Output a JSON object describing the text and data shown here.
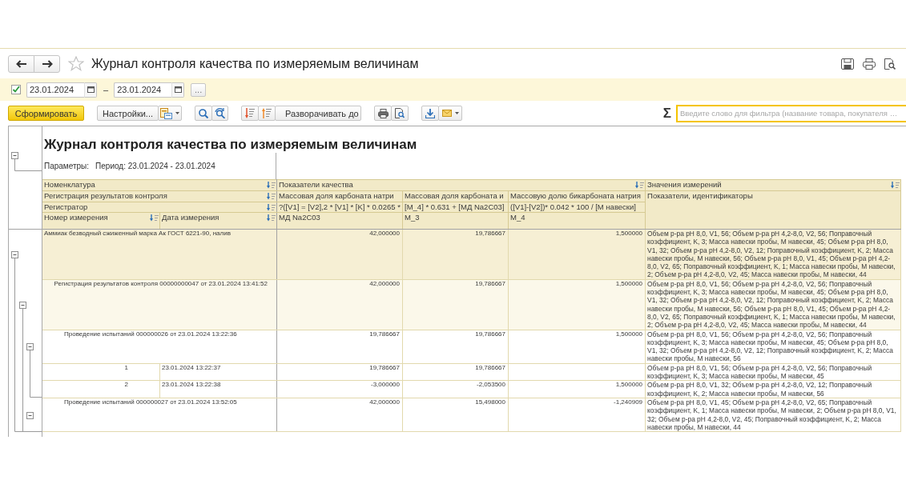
{
  "window": {
    "title": "Журнал контроля качества по измеряемым величинам"
  },
  "period": {
    "enabled": true,
    "from": "23.01.2024",
    "separator": "–",
    "to": "23.01.2024",
    "more_button": "..."
  },
  "toolbar": {
    "generate_button": "Сформировать",
    "settings_button": "Настройки...",
    "expand_button": "Разворачивать до",
    "sum_button": "Σ",
    "filter": {
      "placeholder": "Введите слово для фильтра (название товара, покупателя …"
    }
  },
  "report": {
    "title": "Журнал контроля качества по измеряемым величинам",
    "expanded": true,
    "parameters_label": "Параметры:",
    "period": "Период: 23.01.2024 - 23.01.2024",
    "header": {
      "nomenclature": "Номенклатура",
      "registration": "Регистрация результатов контроля",
      "registrar": "Регистратор",
      "measurement_number": "Номер измерения",
      "measurement_date": "Дата измерения",
      "quality_indicators": "Показатели качества",
      "indicators": [
        {
          "name": "Массовая доля карбоната натри",
          "formula": "?([V1] = [V2],2 * [V1] * [K] * 0.0265 *",
          "code": "МД Na2C03"
        },
        {
          "name": "Массовая доля карбоната и",
          "formula": "[M_4] * 0.631 + [МД Na2C03]",
          "code": "М_3"
        },
        {
          "name": "Массовую долю бикарбоната натрия",
          "formula": "([V1]-[V2])* 0.042 * 100 / [М навески]",
          "code": "М_4"
        }
      ],
      "measured_values": "Значения измерений",
      "identifiers": "Показатели, идентификаторы"
    },
    "rows": [
      {
        "kind": "product",
        "label": "Аммиак безводный сжиженный марка Ак ГОСТ 6221-90, налив",
        "values": [
          "42,000000",
          "19,786667",
          "1,500000"
        ],
        "measurements": "Объем р-ра pH 8,0, V1, 56; Объем р-ра pH 4,2-8,0, V2, 56; Поправочный коэффициент, K, 3; Масса навески пробы, М навески, 45; Объем р-ра pH 8,0, V1, 32; Объем р-ра pH 4,2-8,0, V2, 12; Поправочный коэффициент, K, 2; Масса навески пробы, М навески, 56; Объем р-ра pH 8,0, V1, 45; Объем р-ра pH 4,2-8,0, V2, 65; Поправочный коэффициент, K, 1; Масса навески пробы, М навески, 2; Объем р-ра pH 4,2-8,0, V2, 45; Масса навески пробы, М навески, 44",
        "expanded": true,
        "children": [
          {
            "kind": "registration",
            "label": "Регистрация результатов контроля 00000000047 от 23.01.2024 13:41:52",
            "values": [
              "42,000000",
              "19,786667",
              "1,500000"
            ],
            "measurements": "Объем р-ра pH 8,0, V1, 56; Объем р-ра pH 4,2-8,0, V2, 56; Поправочный коэффициент, K, 3; Масса навески пробы, М навески, 45; Объем р-ра pH 8,0, V1, 32; Объем р-ра pH 4,2-8,0, V2, 12; Поправочный коэффициент, K, 2; Масса навески пробы, М навески, 56; Объем р-ра pH 8,0, V1, 45; Объем р-ра pH 4,2-8,0, V2, 65; Поправочный коэффициент, K, 1; Масса навески пробы, М навески, 2; Объем р-ра pH 4,2-8,0, V2, 45; Масса навески пробы, М навески, 44",
            "expanded": true,
            "children": [
              {
                "kind": "test",
                "label": "Проведение испытаний 000000026 от 23.01.2024 13:22:36",
                "values": [
                  "19,786667",
                  "19,786667",
                  "1,500000"
                ],
                "measurements": "Объем р-ра pH 8,0, V1, 56; Объем р-ра pH 4,2-8,0, V2, 56; Поправочный коэффициент, K, 3; Масса навески пробы, М навески, 45; Объем р-ра pH 8,0, V1, 32; Объем р-ра pH 4,2-8,0, V2, 12; Поправочный коэффициент, K, 2; Масса навески пробы, М навески, 56",
                "expanded": true,
                "children": [
                  {
                    "kind": "measurement",
                    "number": "1",
                    "date": "23.01.2024 13:22:37",
                    "values": [
                      "19,786667",
                      "19,786667"
                    ],
                    "measurements": "Объем р-ра pH 8,0, V1, 56; Объем р-ра pH 4,2-8,0, V2, 56; Поправочный коэффициент, K, 3; Масса навески пробы, М навески, 45"
                  },
                  {
                    "kind": "measurement",
                    "number": "2",
                    "date": "23.01.2024 13:22:38",
                    "values": [
                      "-3,000000",
                      "-2,053500",
                      "1,500000"
                    ],
                    "measurements": "Объем р-ра pH 8,0, V1, 32; Объем р-ра pH 4,2-8,0, V2, 12; Поправочный коэффициент, K, 2; Масса навески пробы, М навески, 56"
                  }
                ]
              },
              {
                "kind": "test",
                "label": "Проведение испытаний 000000027 от 23.01.2024 13:52:05",
                "values": [
                  "42,000000",
                  "15,498000",
                  "-1,240909"
                ],
                "measurements": "Объем р-ра pH 8,0, V1, 45; Объем р-ра pH 4,2-8,0, V2, 65; Поправочный коэффициент, K, 1; Масса навески пробы, М навески, 2; Объем р-ра pH 8,0, V1, 32; Объем р-ра pH 4,2-8,0, V2, 45; Поправочный коэффициент, K, 2; Масса навески пробы, М навески, 44",
                "expanded": true
              }
            ]
          }
        ]
      }
    ]
  }
}
